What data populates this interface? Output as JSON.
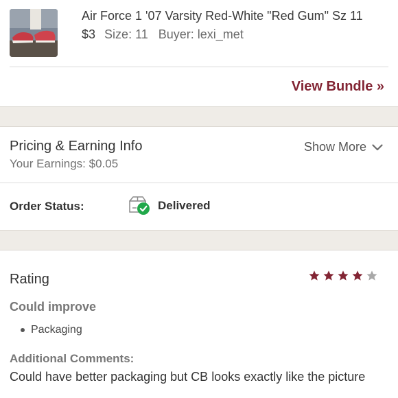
{
  "item": {
    "title": "Air Force 1 '07 Varsity Red-White \"Red Gum\" Sz 11",
    "price": "$3",
    "size": "Size: 11",
    "buyer": "Buyer: lexi_met",
    "thumbnail_icon": "sneaker-photo"
  },
  "bundle": {
    "link_label": "View Bundle »"
  },
  "pricing": {
    "title": "Pricing & Earning Info",
    "earnings": "Your Earnings: $0.05",
    "show_more": "Show More",
    "chevron_icon": "chevron-down-icon"
  },
  "order": {
    "label": "Order Status:",
    "status": "Delivered",
    "status_icon": "delivered-box-check-icon"
  },
  "rating": {
    "title": "Rating",
    "stars": 4,
    "max_stars": 5,
    "star_color": "#822433",
    "empty_star_color": "#a8a8a8",
    "improve_label": "Could improve",
    "improve_items": [
      "Packaging"
    ],
    "comments_label": "Additional Comments:",
    "comments": "Could have better packaging but CB looks exactly like the picture"
  },
  "colors": {
    "accent": "#822433",
    "band": "#efece7",
    "check_green": "#21a84a"
  }
}
